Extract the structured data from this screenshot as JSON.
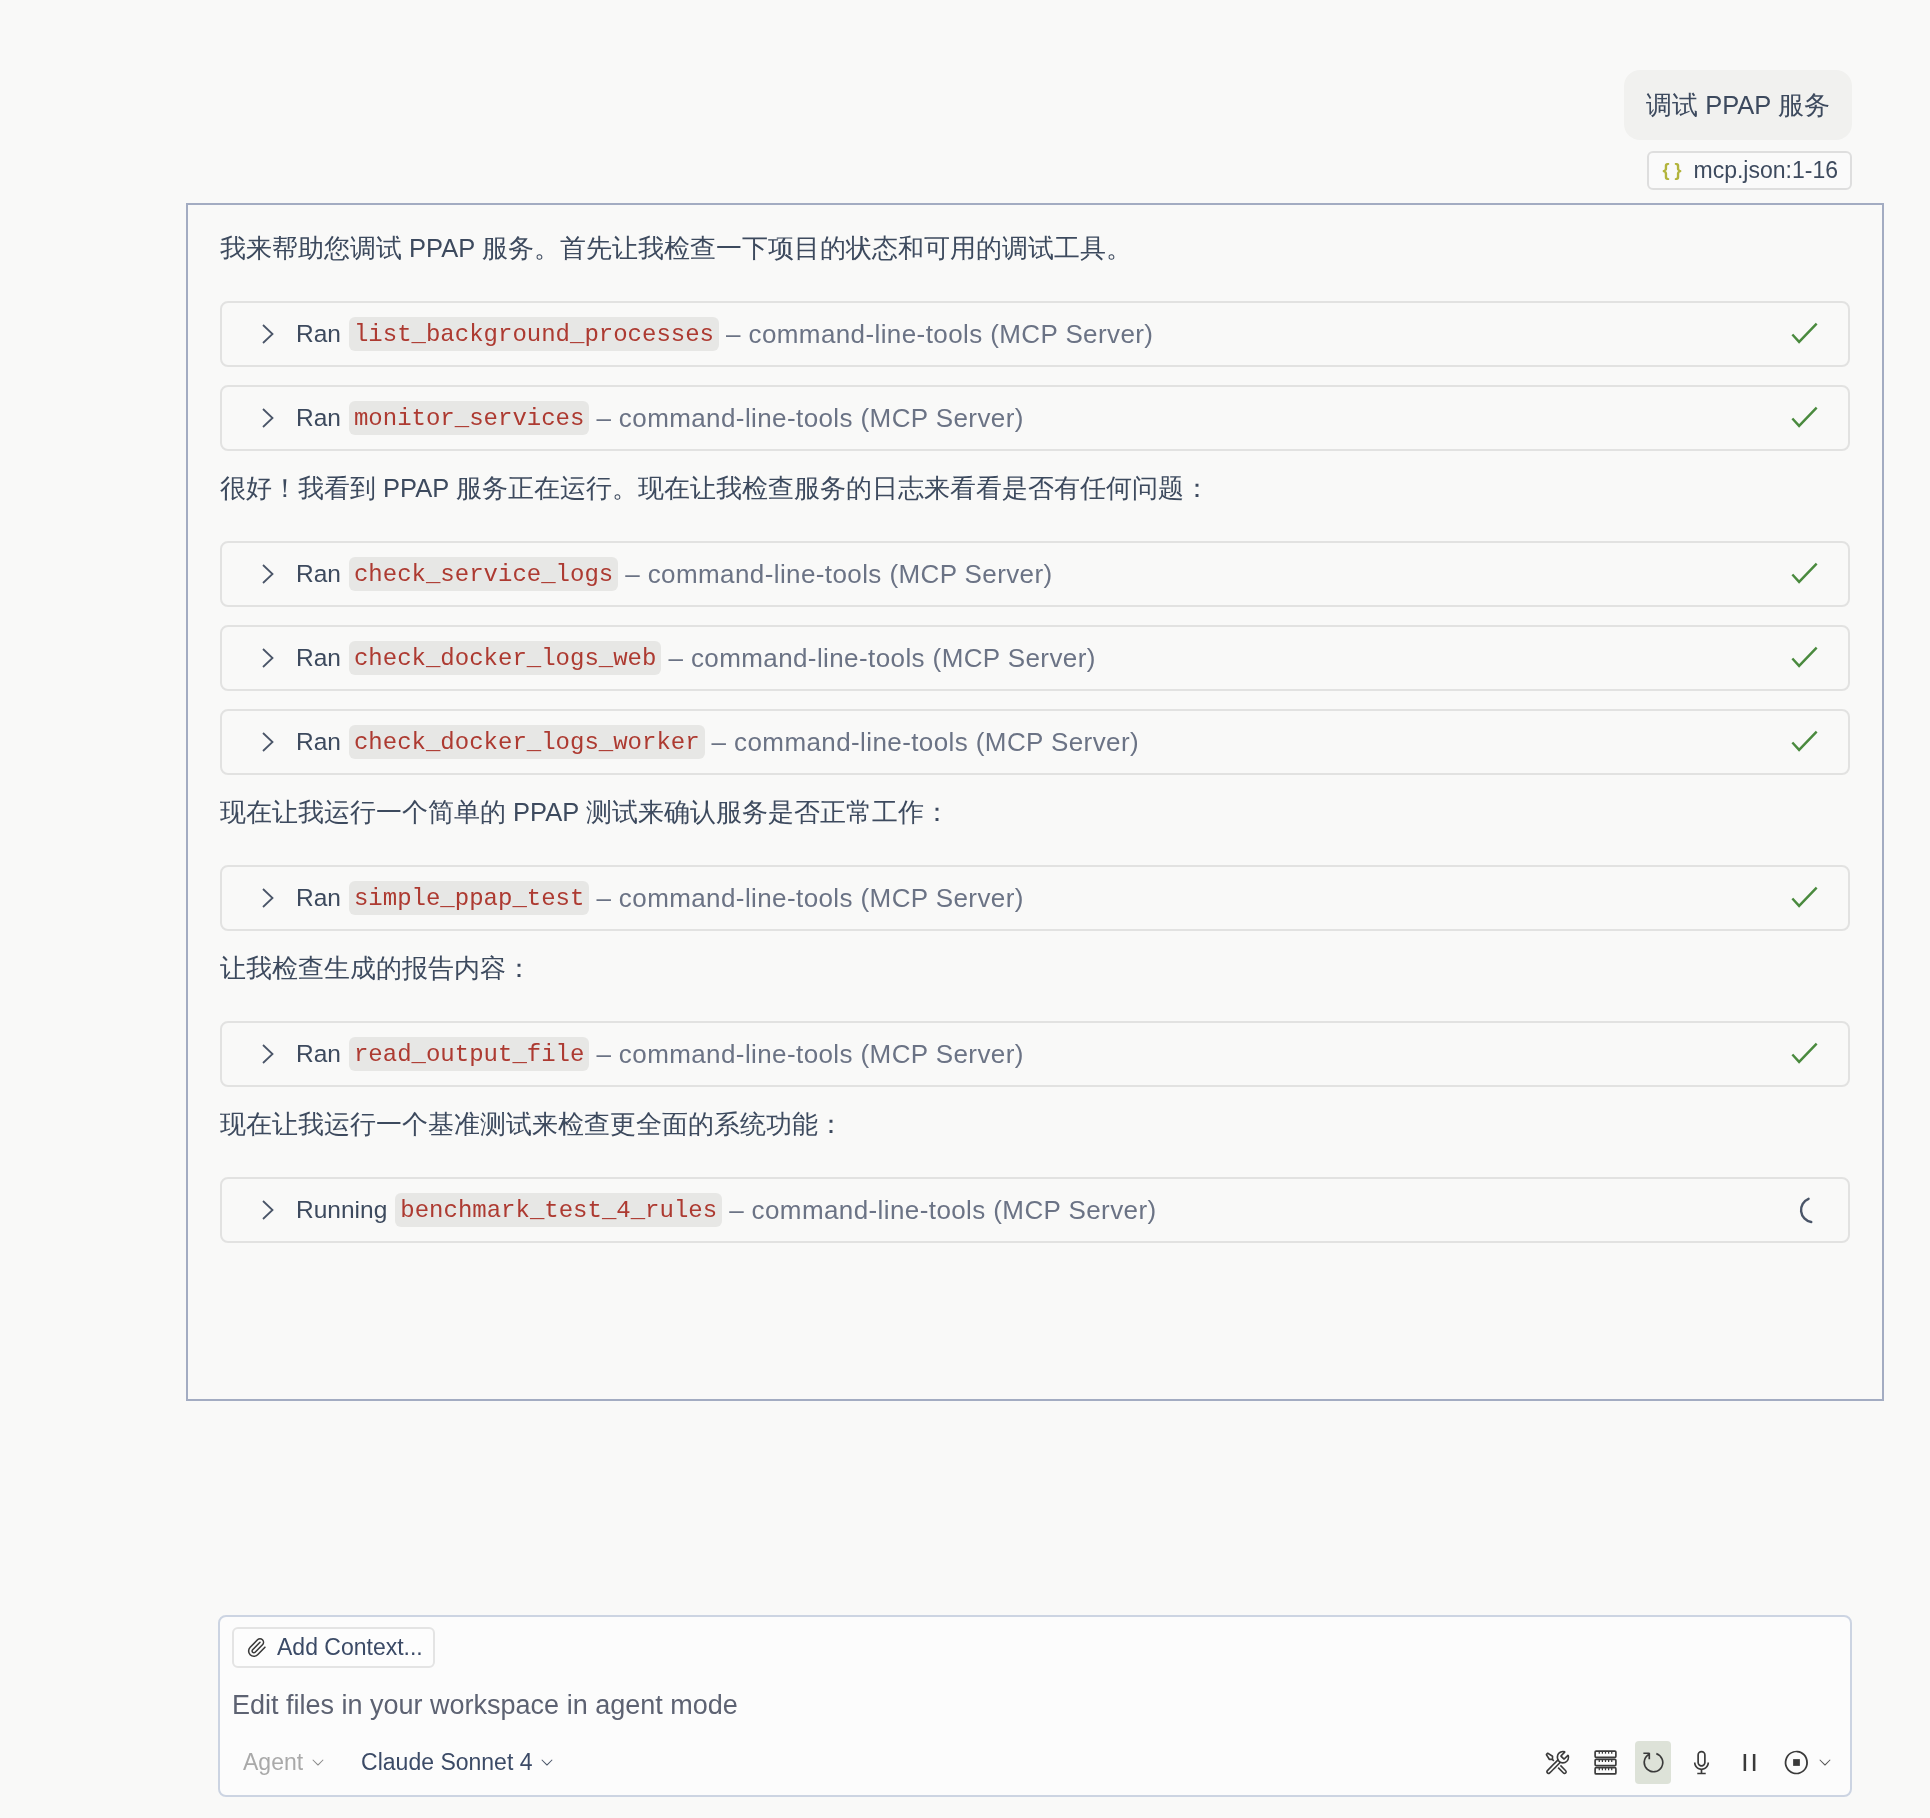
{
  "user_message": {
    "text": "调试 PPAP 服务"
  },
  "attachment": {
    "icon": "{ }",
    "label": "mcp.json:1-16"
  },
  "response": [
    {
      "kind": "text",
      "text": "我来帮助您调试 PPAP 服务。首先让我检查一下项目的状态和可用的调试工具。"
    },
    {
      "kind": "tool",
      "verb": "Ran",
      "tool": "list_background_processes",
      "detail": "– command-line-tools (MCP Server)",
      "complete": true,
      "expanded": false
    },
    {
      "kind": "tool",
      "verb": "Ran",
      "tool": "monitor_services",
      "detail": "– command-line-tools (MCP Server)",
      "complete": true,
      "expanded": false
    },
    {
      "kind": "text",
      "text": "很好！我看到 PPAP 服务正在运行。现在让我检查服务的日志来看看是否有任何问题："
    },
    {
      "kind": "tool",
      "verb": "Ran",
      "tool": "check_service_logs",
      "detail": "– command-line-tools (MCP Server)",
      "complete": true,
      "expanded": false
    },
    {
      "kind": "tool",
      "verb": "Ran",
      "tool": "check_docker_logs_web",
      "detail": "– command-line-tools (MCP Server)",
      "complete": true,
      "expanded": false
    },
    {
      "kind": "tool",
      "verb": "Ran",
      "tool": "check_docker_logs_worker",
      "detail": "– command-line-tools (MCP Server)",
      "complete": true,
      "expanded": false
    },
    {
      "kind": "text",
      "text": "现在让我运行一个简单的 PPAP 测试来确认服务是否正常工作："
    },
    {
      "kind": "tool",
      "verb": "Ran",
      "tool": "simple_ppap_test",
      "detail": "– command-line-tools (MCP Server)",
      "complete": true,
      "expanded": false
    },
    {
      "kind": "text",
      "text": "让我检查生成的报告内容："
    },
    {
      "kind": "tool",
      "verb": "Ran",
      "tool": "read_output_file",
      "detail": "– command-line-tools (MCP Server)",
      "complete": true,
      "expanded": false
    },
    {
      "kind": "text",
      "text": "现在让我运行一个基准测试来检查更全面的系统功能："
    },
    {
      "kind": "tool",
      "verb": "Running",
      "tool": "benchmark_test_4_rules",
      "detail": "– command-line-tools (MCP Server)",
      "complete": false,
      "expanded": false
    }
  ],
  "composer": {
    "add_context": "Add Context...",
    "placeholder": "Edit files in your workspace in agent mode",
    "mode": {
      "label": "Agent",
      "disabled": true
    },
    "model": {
      "label": "Claude Sonnet 4"
    },
    "toolbar": [
      {
        "kind": "tools",
        "selected": false
      },
      {
        "kind": "rulers",
        "selected": false
      },
      {
        "kind": "refresh",
        "selected": true
      },
      {
        "kind": "mic",
        "selected": false
      },
      {
        "kind": "pause",
        "selected": false
      },
      {
        "kind": "stop",
        "selected": false
      }
    ]
  }
}
